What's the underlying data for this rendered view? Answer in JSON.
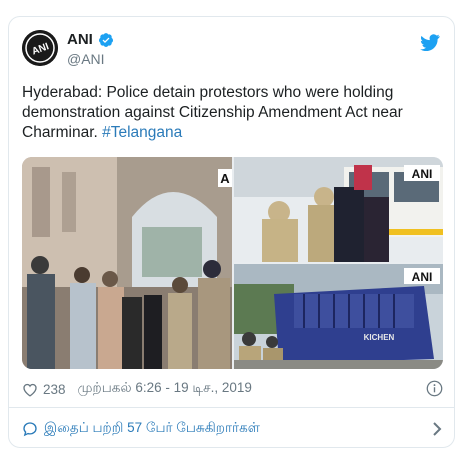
{
  "account": {
    "name": "ANI",
    "handle": "@ANI",
    "avatar_text": "ANI"
  },
  "tweet": {
    "text": "Hyderabad: Police detain protestors who were holding demonstration against Citizenship Amendment Act near Charminar.",
    "hashtag": "#Telangana"
  },
  "media": {
    "watermarks": [
      "A",
      "ANI",
      "ANI"
    ],
    "van_text": "KICHEN"
  },
  "meta": {
    "likes": "238",
    "timestamp": "முற்பகல் 6:26 - 19 டிச., 2019"
  },
  "footer": {
    "discussion_label": "இதைப் பற்றி 57 பேர் பேசுகிறார்கள்"
  },
  "icons": {
    "verified": "verified-badge-icon",
    "twitter": "twitter-bird-icon",
    "like": "heart-icon",
    "info": "info-icon",
    "reply": "speech-bubble-icon",
    "more": "chevron-right-icon"
  },
  "colors": {
    "link": "#2b7bb9",
    "muted": "#697882",
    "twitter_blue": "#1da1f2",
    "border": "#e1e8ed"
  }
}
